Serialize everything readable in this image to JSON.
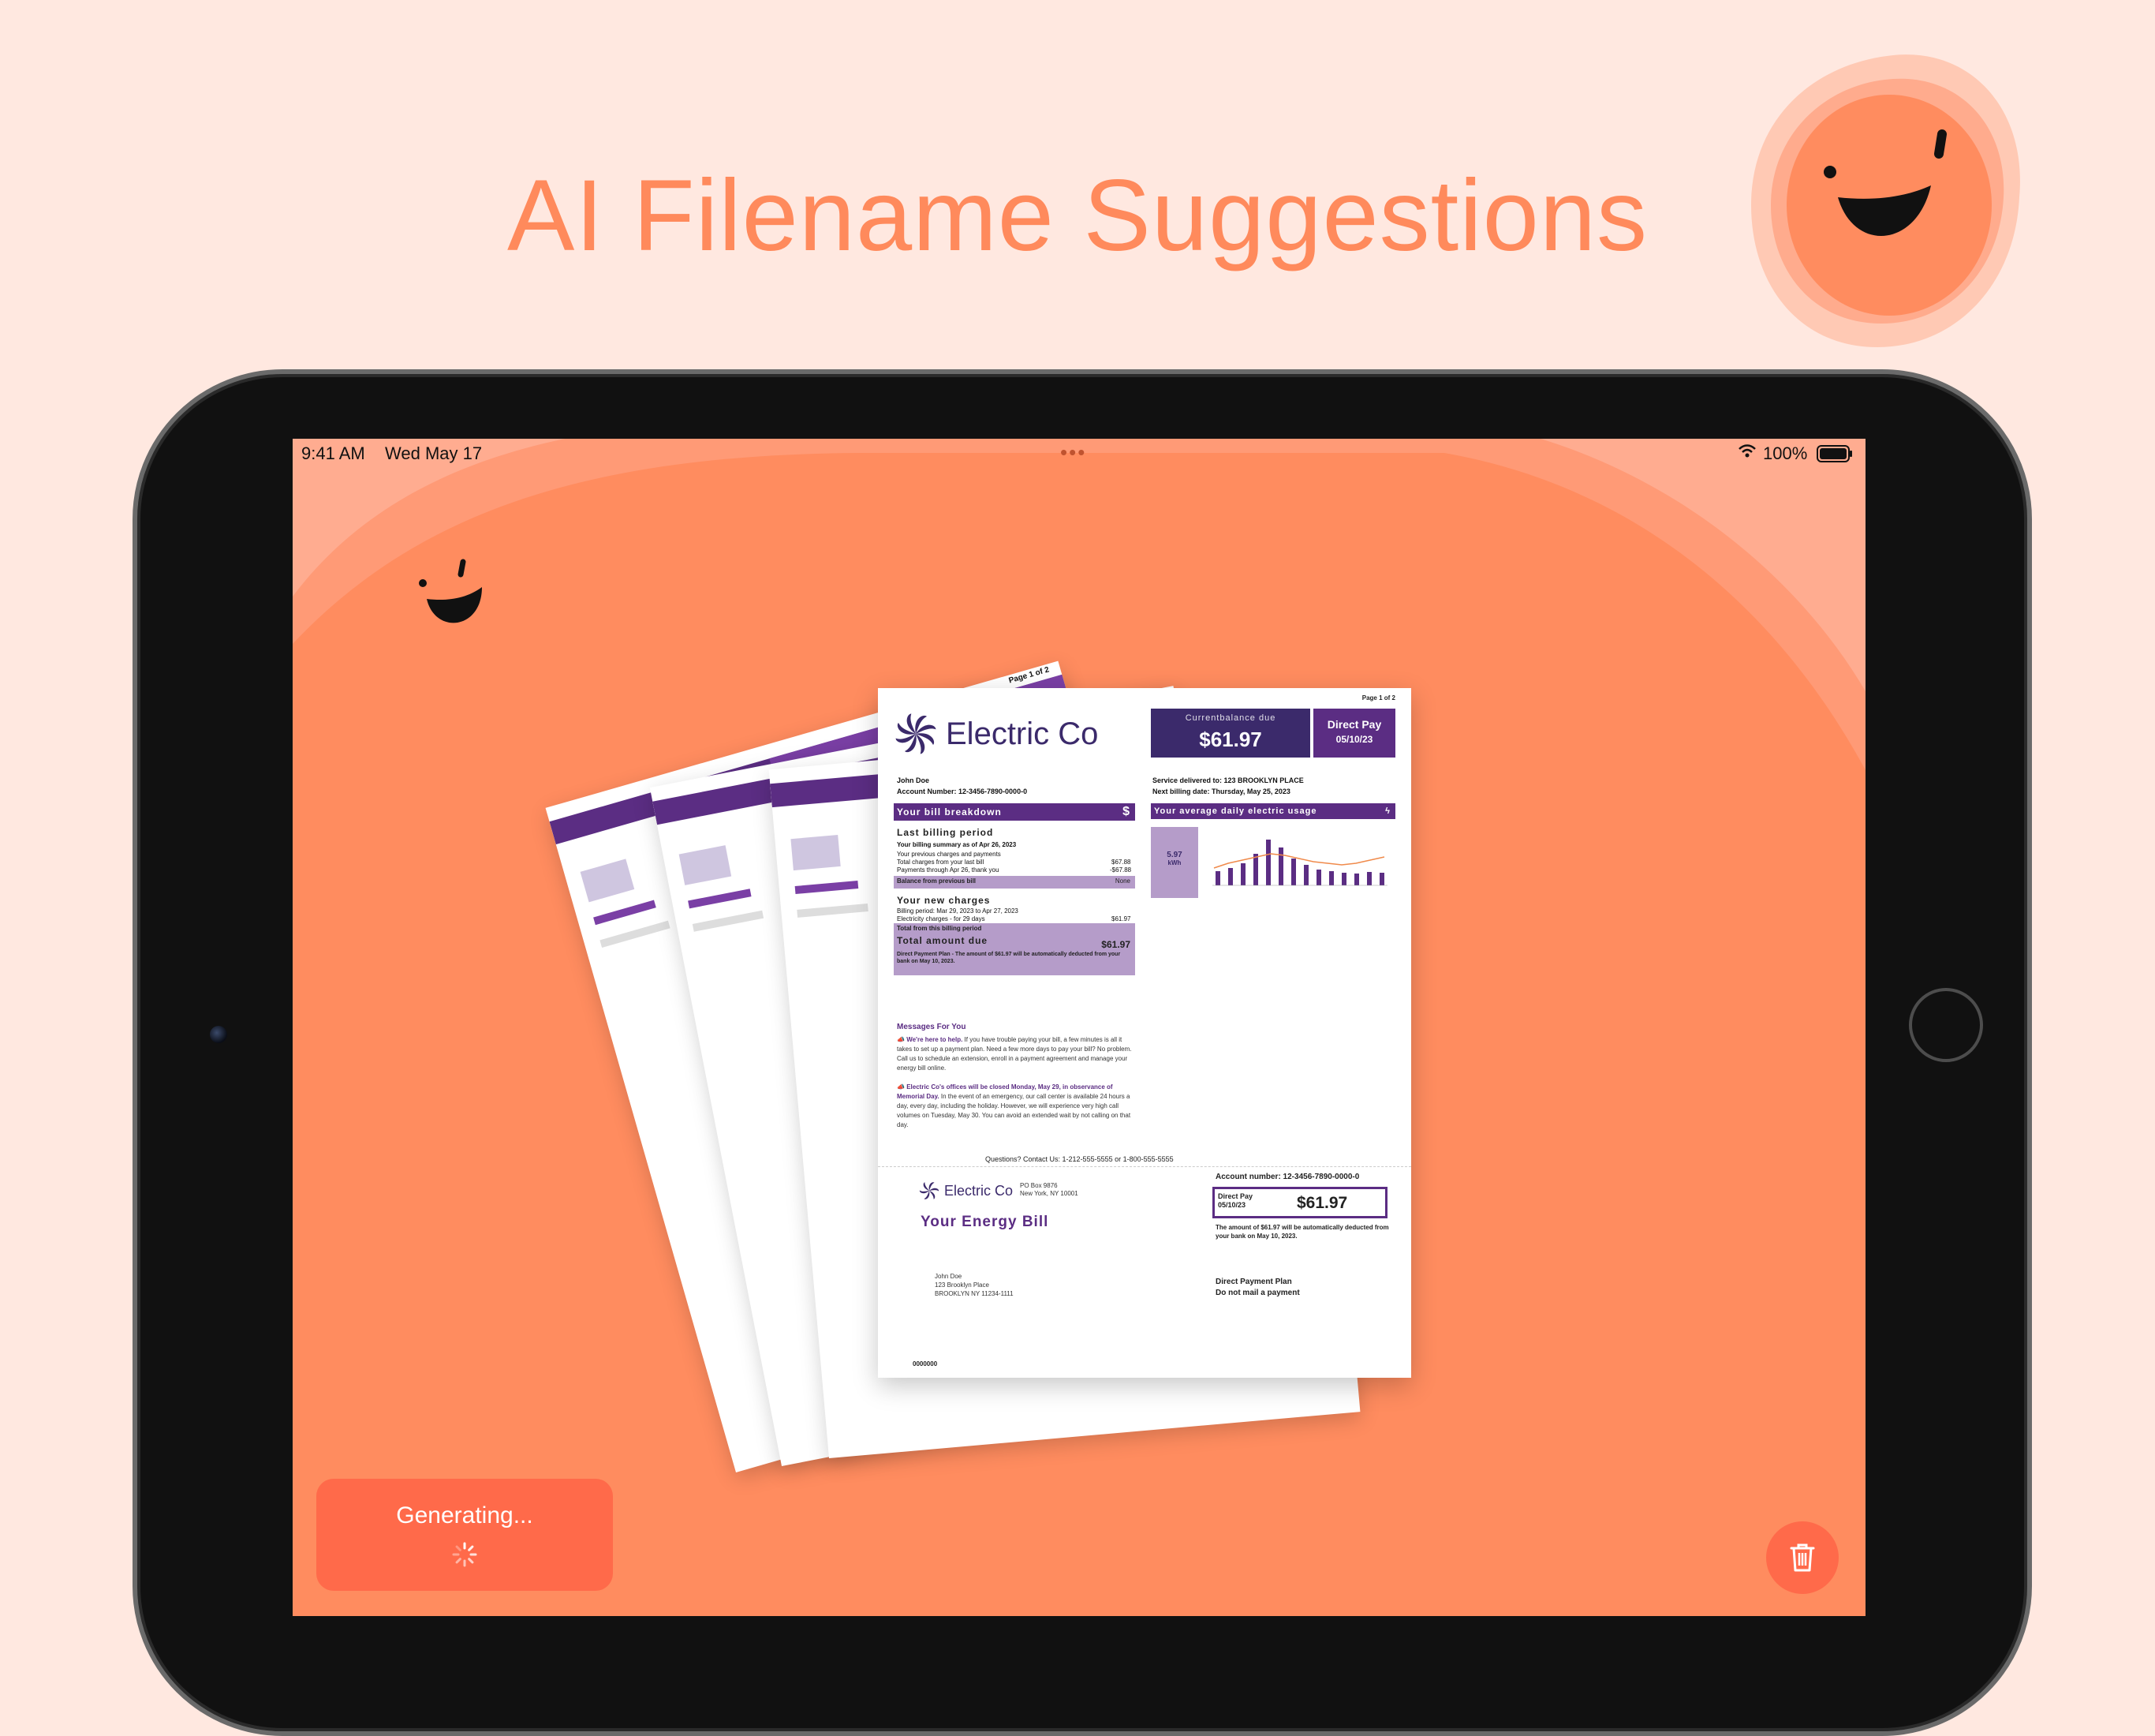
{
  "headline": "AI Filename Suggestions",
  "status_bar": {
    "time": "9:41 AM",
    "date": "Wed May 17",
    "battery": "100%"
  },
  "document": {
    "page_label": "Page 1 of 2",
    "company": "Electric Co",
    "current_balance_label": "Currentbalance due",
    "current_balance": "$61.97",
    "direct_pay_label": "Direct Pay",
    "direct_pay_date": "05/10/23",
    "customer_name": "John Doe",
    "account_number_line": "Account Number:  12-3456-7890-0000-0",
    "service_line": "Service delivered  to: 123 BROOKLYN PLACE",
    "next_billing": "Next billing date: Thursday, May 25, 2023",
    "breakdown_title": "Your bill breakdown",
    "usage_title": "Your average daily electric usage",
    "last_period_title": "Last billing period",
    "summary_line": "Your billing summary as of Apr 26, 2023",
    "prev_charges": "Your previous charges and payments",
    "total_charges": "Total charges from your last bill",
    "payments_through": "Payments through Apr 26, thank you",
    "amount_1": "$67.88",
    "amount_neg": "-$67.88",
    "balance_prev": "Balance from previous bill",
    "balance_none": "None",
    "new_charges_title": "Your new charges",
    "billing_period": "Billing period: Mar 29, 2023 to Apr 27, 2023",
    "electricity_charges": "Electricity charges - for 29 days",
    "amount_2": "$61.97",
    "total_from_period": "Total from this billing period",
    "total_due_label": "Total amount due",
    "total_due": "$61.97",
    "direct_plan_note": "Direct Payment Plan - The amount of $61.97 will be automatically deducted from your bank on May 10, 2023.",
    "usage_value": "5.97",
    "usage_unit": "kWh",
    "messages_title": "Messages For You",
    "msg1_em": "We're here to help.",
    "msg1": " If you have trouble paying your bill, a few minutes is all it takes to set up a payment plan.  Need a few more days to pay your bill? No problem. Call us to schedule an extension, enroll in a payment agreement and manage your energy bill online.",
    "msg2_em": "Electric Co's offices will be closed Monday, May 29, in observance of Memorial Day.",
    "msg2": " In the event of an emergency, our call center is available 24 hours a day, every day, including the holiday. However, we will experience very high call volumes on Tuesday, May 30. You can avoid an extended wait by not calling on that day.",
    "contact": "Questions? Contact Us:  1-212-555-5555 or 1-800-555-5555",
    "stub_addr_1": "PO Box 9876",
    "stub_addr_2": "New York, NY 10001",
    "energy_bill_title": "Your Energy Bill",
    "stub_account": "Account number:  12-3456-7890-0000-0",
    "stub_amount": "$61.97",
    "stub_note": "The amount of $61.97 will be automatically deducted from your bank on May 10, 2023.",
    "addr_name": "John Doe",
    "addr_1": "123 Brooklyn Place",
    "addr_2": "BROOKLYN NY 11234-1111",
    "dpp_1": "Direct Payment Plan",
    "dpp_2": "Do not mail a payment",
    "code": "0000000"
  },
  "generate_button": {
    "label": "Generating..."
  },
  "colors": {
    "background": "#FFE8E0",
    "accent": "#FF8A5C",
    "button": "#FF6A4A",
    "purple": "#5b2d83"
  },
  "icons": {
    "mascot": "smiley-blob-icon",
    "trash": "trash-icon",
    "wifi": "wifi-icon",
    "battery": "battery-icon",
    "spinner": "spinner-icon"
  }
}
